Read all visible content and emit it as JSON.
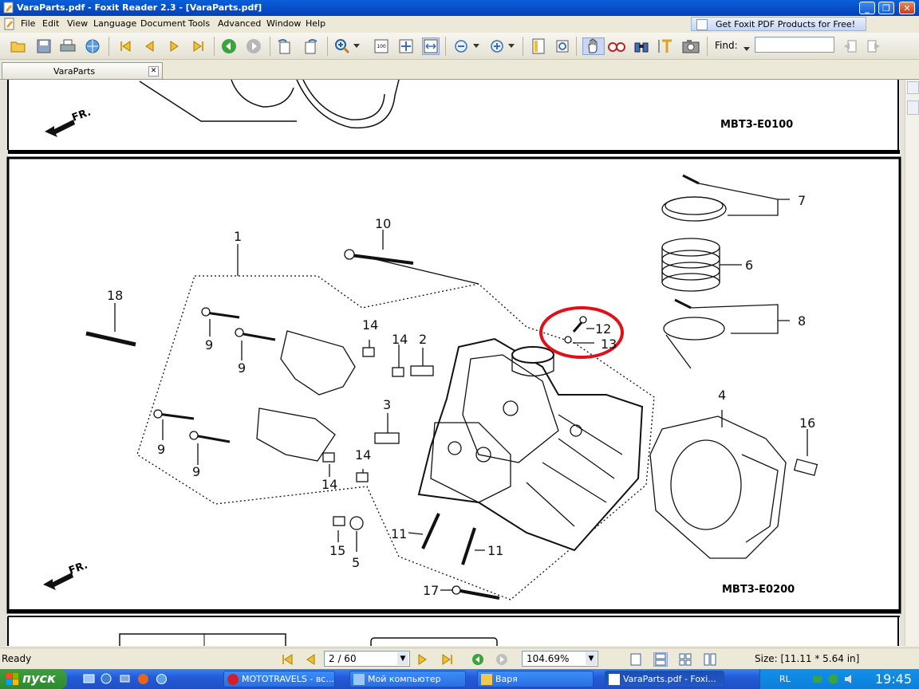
{
  "window": {
    "title": "VaraParts.pdf - Foxit Reader 2.3 - [VaraParts.pdf]",
    "controls": {
      "minimize": "_",
      "restore": "❐",
      "close": "✕"
    }
  },
  "menu": [
    "File",
    "Edit",
    "View",
    "Language",
    "Document",
    "Tools",
    "Advanced",
    "Window",
    "Help"
  ],
  "promo": "Get Foxit PDF Products for Free!",
  "toolbar": {
    "find_label": "Find:",
    "find_value": ""
  },
  "tab": {
    "label": "VaraParts",
    "close": "✕"
  },
  "document": {
    "page1": {
      "code": "MBT3-E0100",
      "fr_label": "FR."
    },
    "page2": {
      "code": "MBT3-E0200",
      "fr_label": "FR.",
      "callouts": [
        "1",
        "2",
        "3",
        "4",
        "5",
        "6",
        "7",
        "8",
        "9",
        "9",
        "9",
        "9",
        "10",
        "11",
        "11",
        "12",
        "13",
        "14",
        "14",
        "14",
        "14",
        "15",
        "16",
        "17",
        "18"
      ]
    }
  },
  "status": {
    "ready": "Ready",
    "page": "2 / 60",
    "zoom": "104.69%",
    "size": "Size: [11.11 * 5.64 in]"
  },
  "taskbar": {
    "start": "пуск",
    "tasks": [
      "MOTOTRAVELS - вс...",
      "Мой компьютер",
      "Варя",
      "VaraParts.pdf - Foxi..."
    ],
    "lang": "RL",
    "clock": "19:45"
  },
  "colors": {
    "highlight_circle": "#e0101a",
    "titlebar": "#0a5fd8",
    "taskbar": "#245bd8",
    "start": "#3f9c3f"
  }
}
